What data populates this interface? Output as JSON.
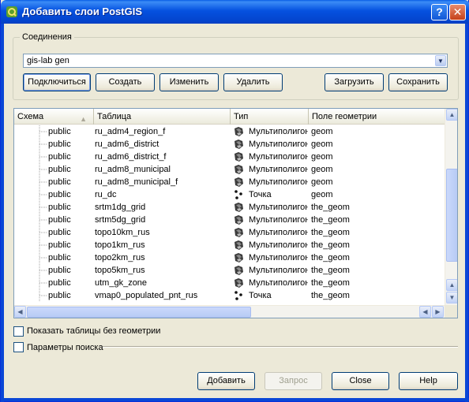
{
  "window": {
    "title": "Добавить слои PostGIS",
    "help_button": "?",
    "close_button": "✕"
  },
  "connections": {
    "group_label": "Соединения",
    "selected": "gis-lab gen",
    "buttons": {
      "connect": "Подключиться",
      "create": "Создать",
      "edit": "Изменить",
      "delete": "Удалить",
      "load": "Загрузить",
      "save": "Сохранить"
    }
  },
  "table": {
    "columns": [
      "Схема",
      "Таблица",
      "Тип",
      "Поле геометрии"
    ],
    "rows": [
      {
        "schema": "public",
        "table": "ru_adm4_region_f",
        "type": "Мультиполигон",
        "type_icon": "multipolygon-icon",
        "geom": "geom"
      },
      {
        "schema": "public",
        "table": "ru_adm6_district",
        "type": "Мультиполигон",
        "type_icon": "multipolygon-icon",
        "geom": "geom"
      },
      {
        "schema": "public",
        "table": "ru_adm6_district_f",
        "type": "Мультиполигон",
        "type_icon": "multipolygon-icon",
        "geom": "geom"
      },
      {
        "schema": "public",
        "table": "ru_adm8_municipal",
        "type": "Мультиполигон",
        "type_icon": "multipolygon-icon",
        "geom": "geom"
      },
      {
        "schema": "public",
        "table": "ru_adm8_municipal_f",
        "type": "Мультиполигон",
        "type_icon": "multipolygon-icon",
        "geom": "geom"
      },
      {
        "schema": "public",
        "table": "ru_dc",
        "type": "Точка",
        "type_icon": "point-icon",
        "geom": "geom"
      },
      {
        "schema": "public",
        "table": "srtm1dg_grid",
        "type": "Мультиполигон",
        "type_icon": "multipolygon-icon",
        "geom": "the_geom"
      },
      {
        "schema": "public",
        "table": "srtm5dg_grid",
        "type": "Мультиполигон",
        "type_icon": "multipolygon-icon",
        "geom": "the_geom"
      },
      {
        "schema": "public",
        "table": "topo10km_rus",
        "type": "Мультиполигон",
        "type_icon": "multipolygon-icon",
        "geom": "the_geom"
      },
      {
        "schema": "public",
        "table": "topo1km_rus",
        "type": "Мультиполигон",
        "type_icon": "multipolygon-icon",
        "geom": "the_geom"
      },
      {
        "schema": "public",
        "table": "topo2km_rus",
        "type": "Мультиполигон",
        "type_icon": "multipolygon-icon",
        "geom": "the_geom"
      },
      {
        "schema": "public",
        "table": "topo5km_rus",
        "type": "Мультиполигон",
        "type_icon": "multipolygon-icon",
        "geom": "the_geom"
      },
      {
        "schema": "public",
        "table": "utm_gk_zone",
        "type": "Мультиполигон",
        "type_icon": "multipolygon-icon",
        "geom": "the_geom"
      },
      {
        "schema": "public",
        "table": "vmap0_populated_pnt_rus",
        "type": "Точка",
        "type_icon": "point-icon",
        "geom": "the_geom"
      }
    ]
  },
  "options": {
    "show_tables_without_geometry": "Показать таблицы без геометрии",
    "search_options": "Параметры поиска"
  },
  "footer": {
    "add": "Добавить",
    "query": "Запрос",
    "close": "Close",
    "help": "Help"
  },
  "colors": {
    "titlebar": "#0551e0",
    "window_bg": "#ece9d8",
    "button_border": "#003c74"
  }
}
